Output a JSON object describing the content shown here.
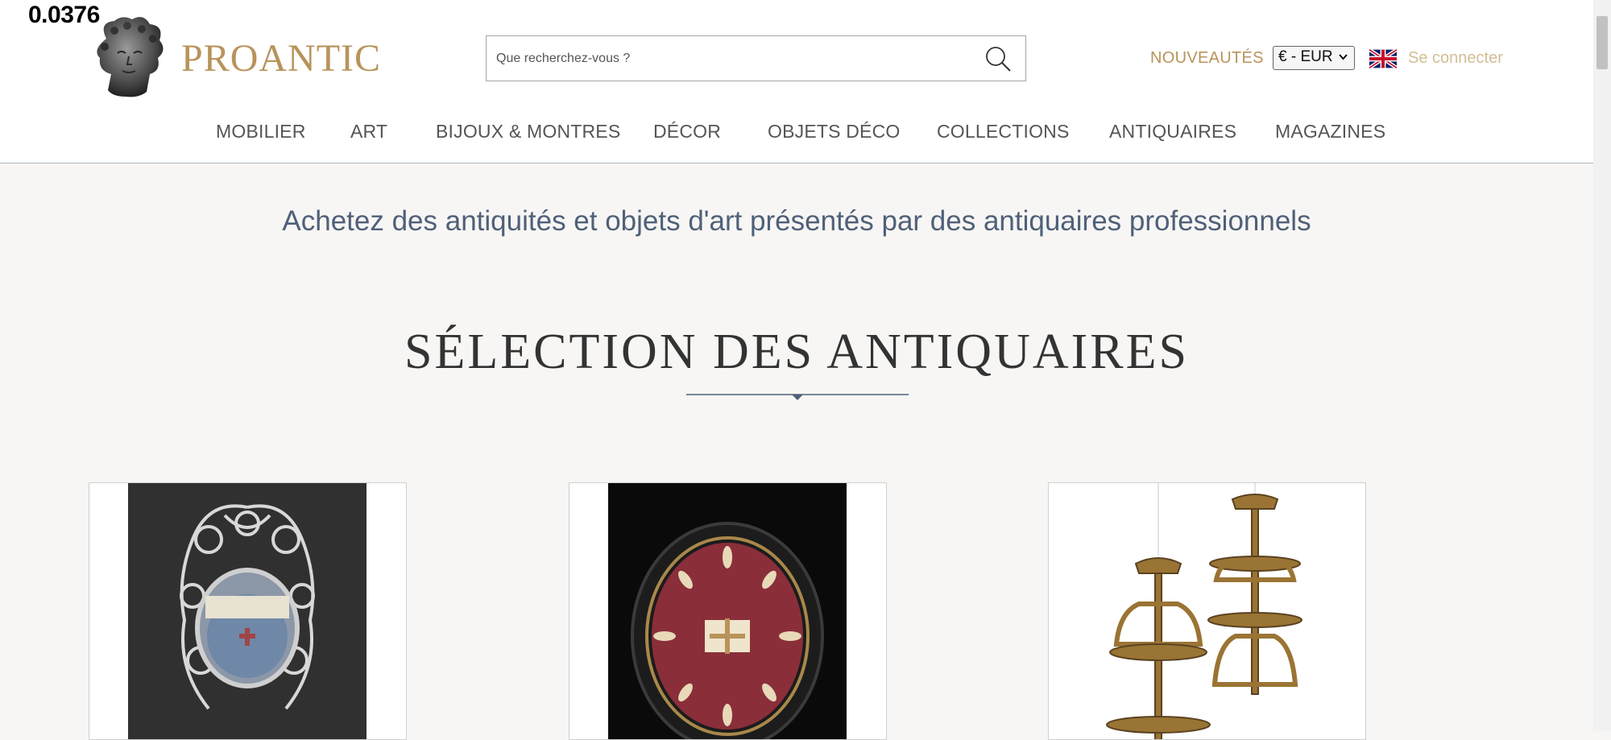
{
  "overlay": {
    "value": "0.0376"
  },
  "header": {
    "logo_text": "PROANTIC",
    "search_placeholder": "Que recherchez-vous ?",
    "new_label": "NOUVEAUTÉS",
    "currency": "€ - EUR",
    "language_flag": "uk-flag-icon",
    "login_label": "Se connecter"
  },
  "nav": {
    "items": [
      "MOBILIER",
      "ART",
      "BIJOUX & MONTRES",
      "DÉCOR",
      "OBJETS DÉCO",
      "COLLECTIONS",
      "ANTIQUAIRES",
      "MAGAZINES"
    ]
  },
  "main": {
    "tagline": "Achetez des antiquités et objets d'art présentés par des antiquaires professionnels",
    "section_title": "SÉLECTION DES ANTIQUAIRES"
  },
  "products": [
    {
      "image": "silver-filigree-reliquary-image"
    },
    {
      "image": "oval-framed-reliquary-image"
    },
    {
      "image": "gilt-wall-shelves-image"
    }
  ],
  "colors": {
    "brand_gold": "#b8935a",
    "accent_blue": "#4f6079",
    "background": "#f7f6f4"
  }
}
